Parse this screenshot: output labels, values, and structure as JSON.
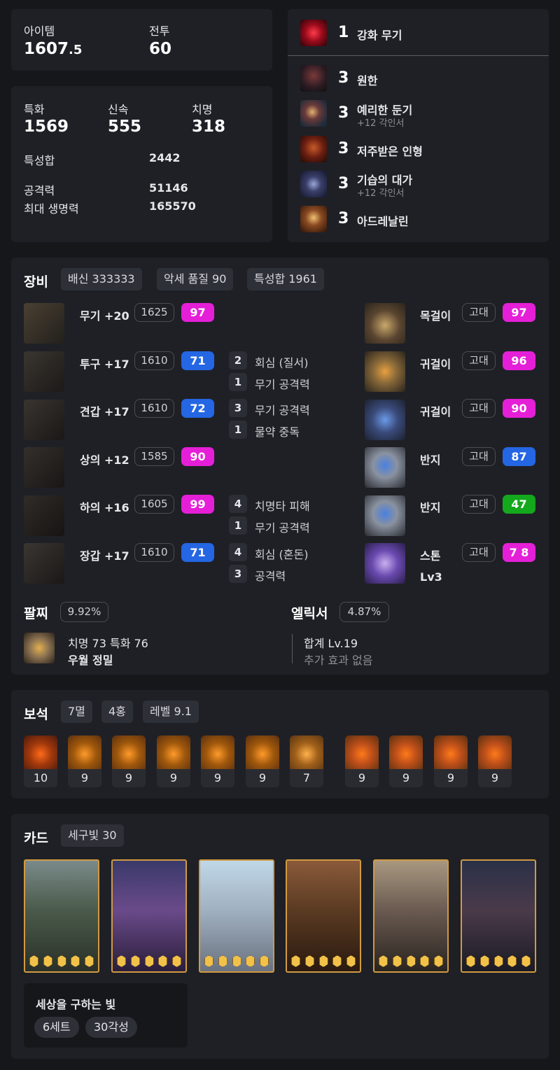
{
  "summary": {
    "item_label": "아이템",
    "item_level_main": "1607",
    "item_level_decimal": ".5",
    "combat_label": "전투",
    "combat_level": "60"
  },
  "stats": {
    "crit_spec_label": "특화",
    "crit_spec_val": "1569",
    "swift_label": "신속",
    "swift_val": "555",
    "crit_label": "치명",
    "crit_val": "318",
    "sum_label": "특성합",
    "sum_val": "2442",
    "atk_label": "공격력",
    "atk_val": "51146",
    "hp_label": "최대 생명력",
    "hp_val": "165570"
  },
  "engravings": {
    "top": {
      "level": "1",
      "name": "강화 무기"
    },
    "items": [
      {
        "level": "3",
        "name": "원한",
        "sub": ""
      },
      {
        "level": "3",
        "name": "예리한 둔기",
        "sub": "+12 각인서"
      },
      {
        "level": "3",
        "name": "저주받은 인형",
        "sub": ""
      },
      {
        "level": "3",
        "name": "기습의 대가",
        "sub": "+12 각인서"
      },
      {
        "level": "3",
        "name": "아드레날린",
        "sub": ""
      }
    ]
  },
  "equipment": {
    "title": "장비",
    "chips": [
      "배신 333333",
      "악세 품질 90",
      "특성합 1961"
    ],
    "armor": [
      {
        "name": "무기 +20",
        "ilvl": "1625",
        "quality": "97",
        "qcolor": "#e51fd7",
        "effects": []
      },
      {
        "name": "투구 +17",
        "ilvl": "1610",
        "quality": "71",
        "qcolor": "#2466e3",
        "effects": [
          {
            "n": "2",
            "t": "회심 (질서)"
          },
          {
            "n": "1",
            "t": "무기 공격력"
          }
        ]
      },
      {
        "name": "견갑 +17",
        "ilvl": "1610",
        "quality": "72",
        "qcolor": "#2466e3",
        "effects": [
          {
            "n": "3",
            "t": "무기 공격력"
          },
          {
            "n": "1",
            "t": "물약 중독"
          }
        ]
      },
      {
        "name": "상의 +12",
        "ilvl": "1585",
        "quality": "90",
        "qcolor": "#e51fd7",
        "effects": []
      },
      {
        "name": "하의 +16",
        "ilvl": "1605",
        "quality": "99",
        "qcolor": "#e51fd7",
        "effects": [
          {
            "n": "4",
            "t": "치명타 피해"
          },
          {
            "n": "1",
            "t": "무기 공격력"
          }
        ]
      },
      {
        "name": "장갑 +17",
        "ilvl": "1610",
        "quality": "71",
        "qcolor": "#2466e3",
        "effects": [
          {
            "n": "4",
            "t": "회심 (혼돈)"
          },
          {
            "n": "3",
            "t": "공격력"
          }
        ]
      }
    ],
    "accessories": [
      {
        "name": "목걸이",
        "grade": "고대",
        "quality": "97",
        "qcolor": "#e51fd7"
      },
      {
        "name": "귀걸이",
        "grade": "고대",
        "quality": "96",
        "qcolor": "#e51fd7"
      },
      {
        "name": "귀걸이",
        "grade": "고대",
        "quality": "90",
        "qcolor": "#e51fd7"
      },
      {
        "name": "반지",
        "grade": "고대",
        "quality": "87",
        "qcolor": "#2466e3"
      },
      {
        "name": "반지",
        "grade": "고대",
        "quality": "47",
        "qcolor": "#14a81c"
      },
      {
        "name": "스톤",
        "grade": "고대",
        "quality": "7 8",
        "qcolor": "#e51fd7",
        "sub": "Lv3"
      }
    ],
    "bracelet": {
      "title": "팔찌",
      "pct": "9.92%",
      "line1": "치명 73  특화 76",
      "line2": "우월  정밀"
    },
    "elixir": {
      "title": "엘릭서",
      "pct": "4.87%",
      "line1": "합계 Lv.19",
      "line2": "추가 효과 없음"
    }
  },
  "gems": {
    "title": "보석",
    "chips": [
      "7멸",
      "4홍",
      "레벨 9.1"
    ],
    "levels": [
      "10",
      "9",
      "9",
      "9",
      "9",
      "9",
      "7",
      "9",
      "9",
      "9",
      "9"
    ]
  },
  "cards": {
    "title": "카드",
    "chip": "세구빛 30",
    "set_name": "세상을 구하는 빛",
    "set_tags": [
      "6세트",
      "30각성"
    ]
  }
}
